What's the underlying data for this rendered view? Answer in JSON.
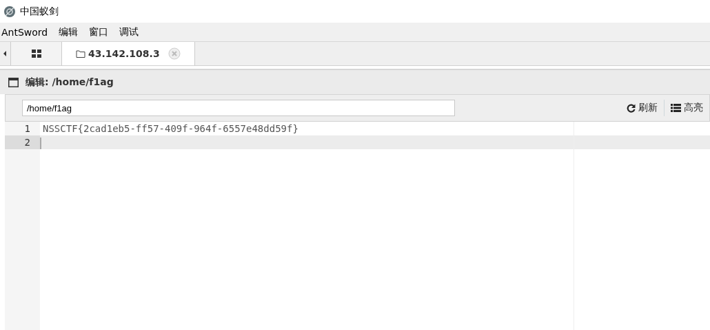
{
  "window": {
    "title": "中国蚁剑"
  },
  "menu": [
    "AntSword",
    "编辑",
    "窗口",
    "调试"
  ],
  "tabs": [
    {
      "kind": "home",
      "selected": false
    },
    {
      "kind": "folder",
      "label": "43.142.108.3",
      "selected": true
    }
  ],
  "panel": {
    "title": "编辑: /home/f1ag",
    "path": "/home/f1ag",
    "buttons": [
      {
        "kind": "refresh",
        "label": "刷新"
      },
      {
        "kind": "highlight",
        "label": "高亮"
      }
    ]
  },
  "editor": {
    "lines": [
      {
        "number": "1",
        "text": "NSSCTF{2cad1eb5-ff57-409f-964f-6557e48dd59f}",
        "active": false
      },
      {
        "number": "2",
        "active": true
      }
    ]
  }
}
